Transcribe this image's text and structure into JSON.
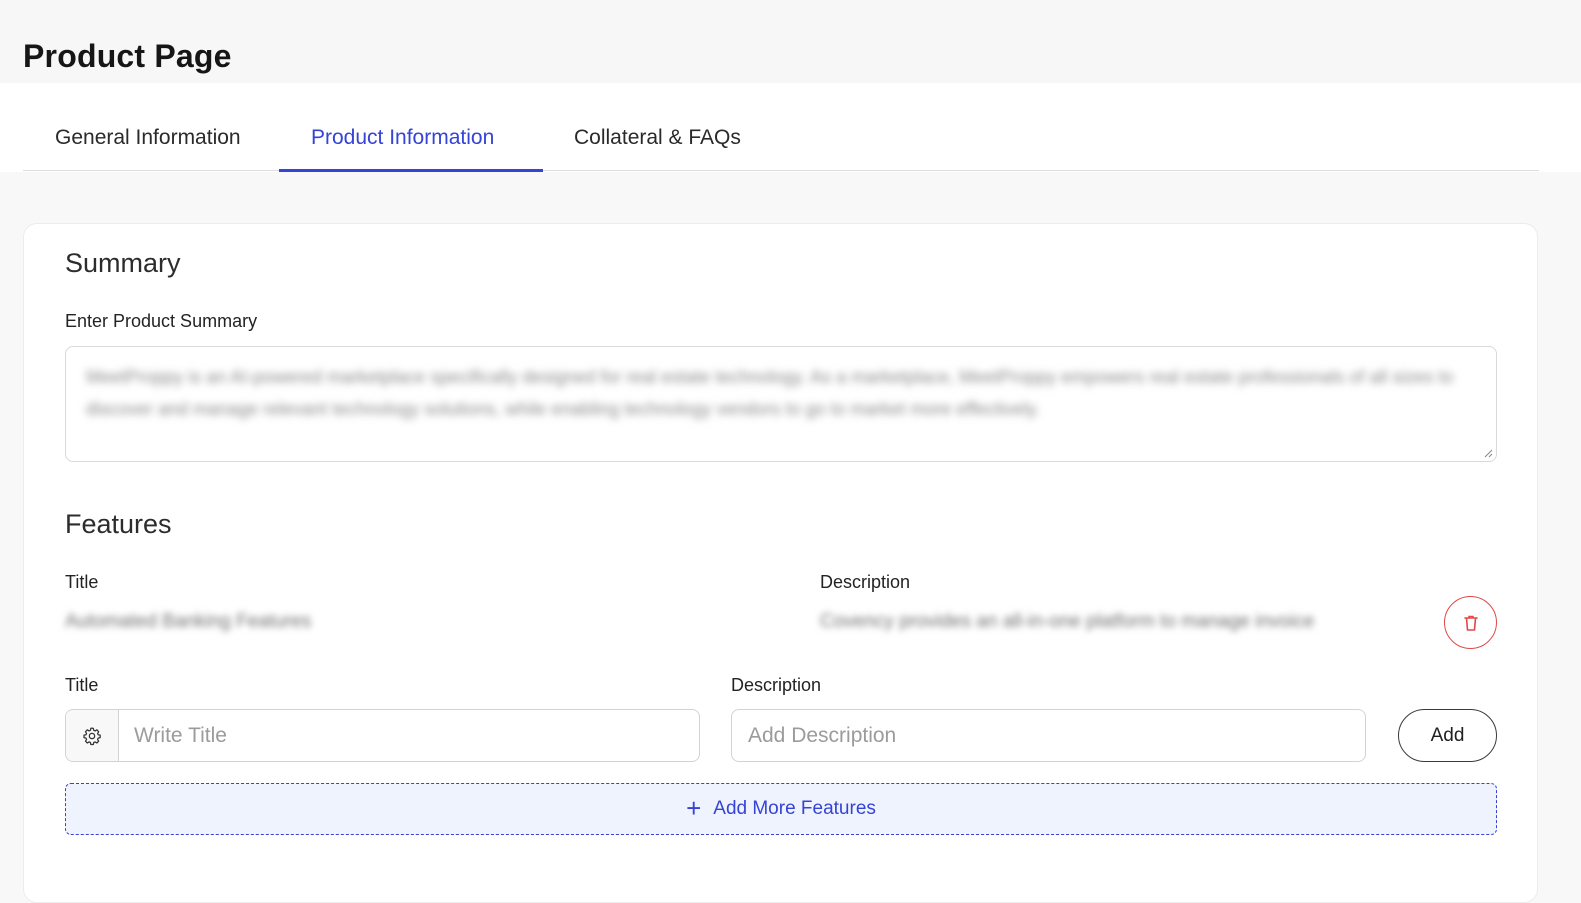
{
  "page": {
    "title": "Product Page"
  },
  "tabs": [
    {
      "label": "General Information",
      "active": false
    },
    {
      "label": "Product Information",
      "active": true
    },
    {
      "label": "Collateral & FAQs",
      "active": false
    }
  ],
  "summary": {
    "heading": "Summary",
    "field_label": "Enter Product Summary",
    "value": "MeetProppy is an AI-powered marketplace specifically designed for real estate technology. As a marketplace, MeetProppy empowers real estate professionals of all sizes to discover and manage relevant technology solutions, while enabling technology vendors to go to market more effectively."
  },
  "features": {
    "heading": "Features",
    "list_title_label": "Title",
    "list_description_label": "Description",
    "items": [
      {
        "title": "Automated Banking Features",
        "description": "Covency provides an all-in-one platform to manage invoice"
      }
    ],
    "new_title_label": "Title",
    "new_description_label": "Description",
    "title_placeholder": "Write Title",
    "description_placeholder": "Add Description",
    "add_label": "Add",
    "add_more_label": "Add More Features"
  },
  "colors": {
    "accent": "#3543d6",
    "danger": "#e24848",
    "add_more_bg": "#eff3fe"
  },
  "icons": {
    "title_prefix": "gear-icon",
    "delete": "trash-icon",
    "add_more": "plus-icon"
  }
}
